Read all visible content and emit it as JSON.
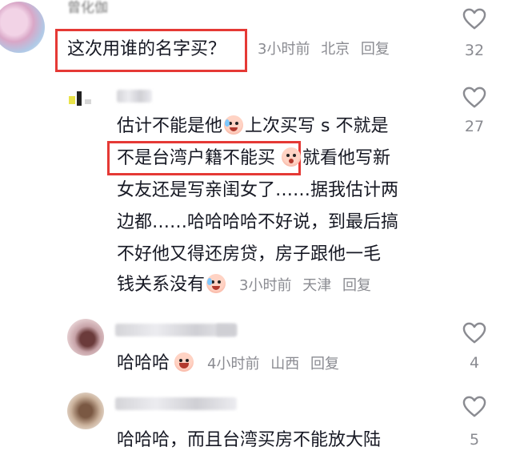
{
  "comments": [
    {
      "username_blurred": "曾化伽",
      "text_lines": [
        "这次用谁的名字买？"
      ],
      "time": "3小时前",
      "location": "北京",
      "reply_label": "回复",
      "likes": "32"
    },
    {
      "text_lines": [
        "估计不能是他",
        "上次买写 s 不就是",
        "不是台湾户籍不能买",
        "就看他写新",
        "女友还是写亲闺女了……据我估计两",
        "边都……哈哈哈哈不好说，到最后搞",
        "不好他又得还房贷，房子跟他一毛",
        "钱关系没有"
      ],
      "time": "3小时前",
      "location": "天津",
      "reply_label": "回复",
      "likes": "27"
    },
    {
      "text_lines": [
        "哈哈哈"
      ],
      "time": "4小时前",
      "location": "山西",
      "reply_label": "回复",
      "likes": "4"
    },
    {
      "text_lines": [
        "哈哈哈，而且台湾买房不能放大陆"
      ],
      "likes": "5"
    }
  ],
  "icons": {
    "like": "heart-outline-icon",
    "emoji_cry": "crying-laugh-emoji",
    "emoji_shock": "shocked-emoji",
    "emoji_laugh": "grinning-emoji"
  },
  "colors": {
    "highlight": "#e53935",
    "meta_text": "#8a8b91",
    "body_text": "#161823"
  }
}
